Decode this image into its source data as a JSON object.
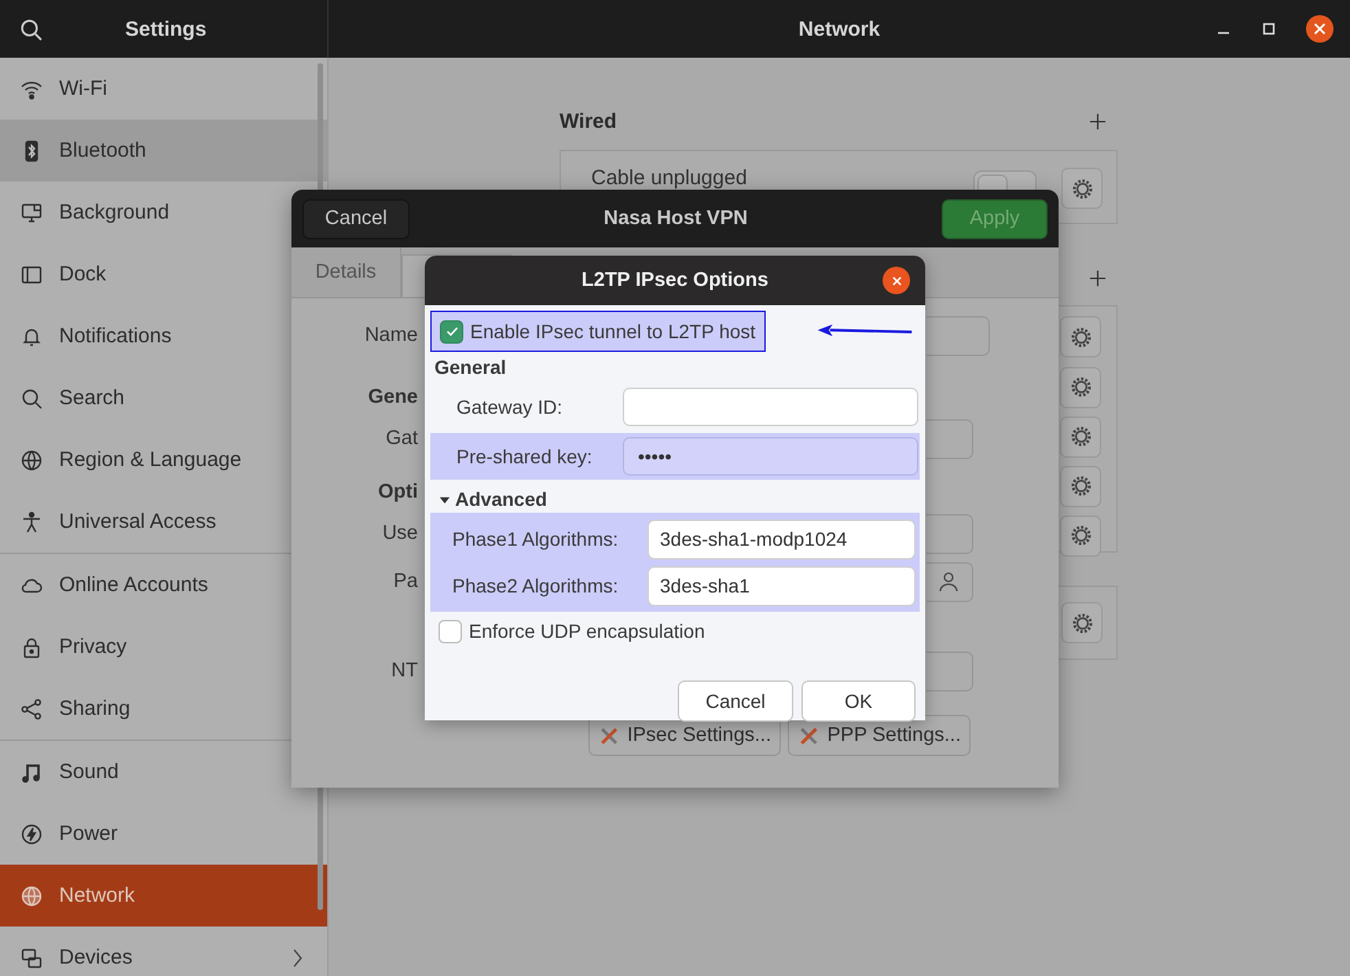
{
  "window": {
    "title": "Network"
  },
  "sidebar": {
    "title": "Settings",
    "groups": [
      {
        "items": [
          {
            "label": "Wi-Fi",
            "selected": false,
            "hovered": false,
            "submenu": false
          },
          {
            "label": "Bluetooth",
            "selected": false,
            "hovered": true,
            "submenu": false
          },
          {
            "label": "Background",
            "selected": false,
            "hovered": false,
            "submenu": false
          },
          {
            "label": "Dock",
            "selected": false,
            "hovered": false,
            "submenu": false
          },
          {
            "label": "Notifications",
            "selected": false,
            "hovered": false,
            "submenu": false
          },
          {
            "label": "Search",
            "selected": false,
            "hovered": false,
            "submenu": false
          },
          {
            "label": "Region & Language",
            "selected": false,
            "hovered": false,
            "submenu": false
          },
          {
            "label": "Universal Access",
            "selected": false,
            "hovered": false,
            "submenu": false
          }
        ]
      },
      {
        "items": [
          {
            "label": "Online Accounts",
            "selected": false,
            "hovered": false,
            "submenu": false
          },
          {
            "label": "Privacy",
            "selected": false,
            "hovered": false,
            "submenu": false
          },
          {
            "label": "Sharing",
            "selected": false,
            "hovered": false,
            "submenu": false
          }
        ]
      },
      {
        "items": [
          {
            "label": "Sound",
            "selected": false,
            "hovered": false,
            "submenu": false
          },
          {
            "label": "Power",
            "selected": false,
            "hovered": false,
            "submenu": false
          },
          {
            "label": "Network",
            "selected": true,
            "hovered": false,
            "submenu": false
          },
          {
            "label": "Devices",
            "selected": false,
            "hovered": false,
            "submenu": true
          }
        ]
      }
    ]
  },
  "network": {
    "wired": {
      "heading": "Wired",
      "status": "Cable unplugged",
      "on": false
    }
  },
  "vpn_dialog": {
    "title": "Nasa Host VPN",
    "cancel": "Cancel",
    "apply": "Apply",
    "tabs": [
      {
        "label": "Details",
        "selected": false
      },
      {
        "selected": true
      }
    ],
    "rows": [
      {
        "kind": "field",
        "label": "Name"
      },
      {
        "kind": "heading",
        "label": "Gene"
      },
      {
        "kind": "field",
        "label": "Gat"
      },
      {
        "kind": "heading",
        "label": "Opti"
      },
      {
        "kind": "field",
        "label": "Use"
      },
      {
        "kind": "user_field",
        "label": "Pa"
      },
      {
        "kind": "field",
        "label": "NT"
      }
    ],
    "buttons": [
      "IPsec Settings...",
      "PPP Settings..."
    ]
  },
  "l2tp_dialog": {
    "title": "L2TP IPsec Options",
    "enable": {
      "label": "Enable IPsec tunnel to L2TP host",
      "checked": true,
      "highlighted": true
    },
    "general": "General",
    "general_fields": [
      {
        "label": "Gateway ID:",
        "highlighted": false
      },
      {
        "label": "Pre-shared key:",
        "value": "•••••",
        "highlighted": true
      }
    ],
    "advanced": {
      "label": "Advanced",
      "expanded": true,
      "highlighted": true,
      "fields": [
        {
          "label": "Phase1 Algorithms:",
          "value": "3des-sha1-modp1024"
        },
        {
          "label": "Phase2 Algorithms:",
          "value": "3des-sha1"
        }
      ]
    },
    "enforce_udp": {
      "label": "Enforce UDP encapsulation",
      "checked": false
    },
    "buttons": [
      "Cancel",
      "OK"
    ]
  }
}
